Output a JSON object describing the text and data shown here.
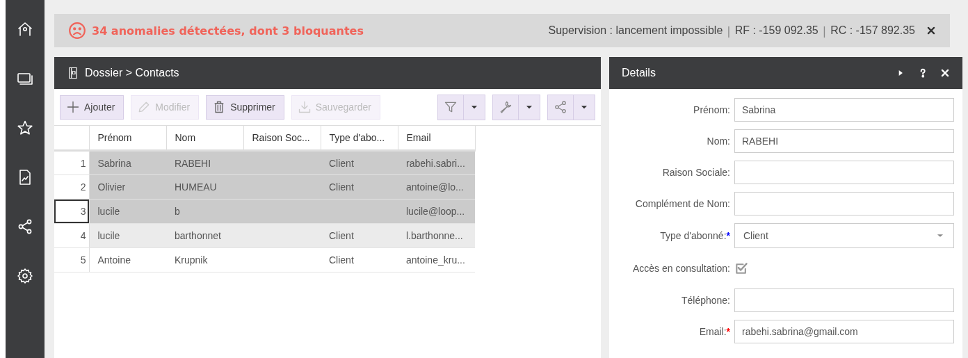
{
  "banner": {
    "message": "34 anomalies détectées, dont 3 bloquantes",
    "separator": "|",
    "status": [
      "Supervision :  lancement impossible",
      "RF : -159 092.35",
      "RC : -157 892.35"
    ]
  },
  "contacts": {
    "title": "Dossier > Contacts",
    "toolbar": [
      {
        "label": "Ajouter",
        "disabled": false
      },
      {
        "label": "Modifier",
        "disabled": true
      },
      {
        "label": "Supprimer",
        "disabled": false
      },
      {
        "label": "Sauvegarder",
        "disabled": true
      }
    ],
    "columns": [
      "Prénom",
      "Nom",
      "Raison Soc...",
      "Type d'abo...",
      "Email"
    ],
    "rows": [
      {
        "num": "1",
        "cells": [
          "Sabrina",
          "RABEHI",
          null,
          "Client",
          "rabehi.sabri..."
        ],
        "selected": true,
        "hovered": false,
        "focused": false
      },
      {
        "num": "2",
        "cells": [
          "Olivier",
          "HUMEAU",
          null,
          "Client",
          "antoine@lo..."
        ],
        "selected": true,
        "hovered": false,
        "focused": false
      },
      {
        "num": "3",
        "cells": [
          "lucile",
          "b",
          null,
          null,
          "lucile@loop..."
        ],
        "selected": true,
        "hovered": false,
        "focused": true
      },
      {
        "num": "4",
        "cells": [
          "lucile",
          "barthonnet",
          null,
          "Client",
          "l.barthonne..."
        ],
        "selected": false,
        "hovered": true,
        "focused": false
      },
      {
        "num": "5",
        "cells": [
          "Antoine",
          "Krupnik",
          null,
          "Client",
          "antoine_kru..."
        ],
        "selected": false,
        "hovered": false,
        "focused": false
      }
    ]
  },
  "details": {
    "title": "Details",
    "fields": [
      {
        "kind": "text",
        "label": "Prénom:",
        "value": "Sabrina"
      },
      {
        "kind": "text",
        "label": "Nom:",
        "value": "RABEHI"
      },
      {
        "kind": "text",
        "label": "Raison Sociale:"
      },
      {
        "kind": "text",
        "label": "Complément de Nom:"
      },
      {
        "kind": "select",
        "label": "Type d'abonné:",
        "required_mark": "*",
        "color": "#0000ff",
        "value": "Client"
      },
      {
        "kind": "checkbox",
        "label": "Accès en consultation:",
        "checked": true
      },
      {
        "kind": "text",
        "label": "Téléphone:"
      },
      {
        "kind": "text",
        "label": "Email:",
        "required_mark": "*",
        "color": "#ff0000",
        "value": "rabehi.sabrina@gmail.com"
      }
    ]
  }
}
